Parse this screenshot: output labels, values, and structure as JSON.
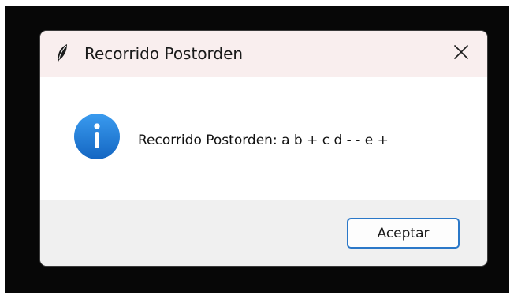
{
  "window": {
    "title": "Recorrido Postorden",
    "app_icon": "feather-icon",
    "close_icon": "close-icon"
  },
  "dialog": {
    "icon": "info-icon",
    "message": "Recorrido Postorden: a b + c d - - e +",
    "ok_label": "Aceptar"
  },
  "colors": {
    "titlebar_bg": "#f9eeee",
    "footer_bg": "#f0f0f0",
    "accent": "#2b78c8",
    "info_icon": "#1b7fd6",
    "backdrop": "#070707"
  }
}
